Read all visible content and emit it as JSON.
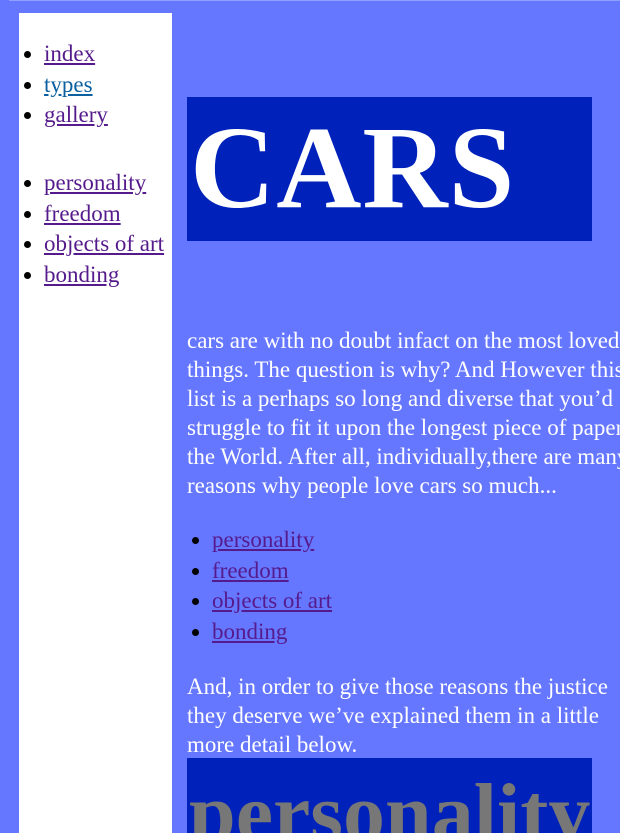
{
  "sidebar": {
    "nav_primary": [
      {
        "label": "index"
      },
      {
        "label": "types"
      },
      {
        "label": "gallery"
      }
    ],
    "nav_sections": [
      {
        "label": "personality"
      },
      {
        "label": "freedom"
      },
      {
        "label": "objects of art"
      },
      {
        "label": "bonding"
      }
    ]
  },
  "main": {
    "title": "CARS",
    "intro": "cars are with no doubt infact on the most loved things. The question is why? And However this list is a perhaps so long and diverse that you’d struggle to fit it upon the longest piece of paper in the World. After all, individually,there are many reasons why people love cars so much...",
    "reasons": [
      {
        "label": "personality"
      },
      {
        "label": "freedom"
      },
      {
        "label": "objects of art"
      },
      {
        "label": "bonding"
      }
    ],
    "outro": "And, in order to give those reasons the justice they deserve we’ve explained them in a little more detail below.",
    "section_heading": "personality"
  },
  "colors": {
    "page_background": "#6677ff",
    "title_box": "#0022bb",
    "visited_link": "#551a8b",
    "link": "#0a60a0",
    "heading_grey": "#777777"
  }
}
